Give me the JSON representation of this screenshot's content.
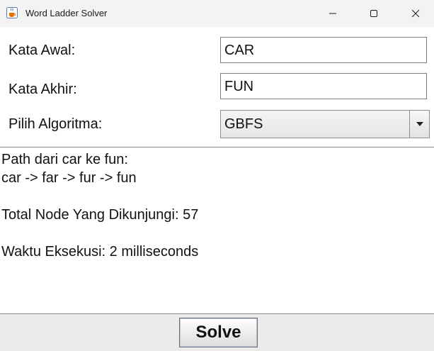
{
  "window": {
    "title": "Word Ladder Solver",
    "app_icon": "java-cup-icon",
    "controls": [
      "minimize-icon",
      "maximize-icon",
      "close-icon"
    ]
  },
  "form": {
    "start_label": "Kata Awal:",
    "start_value": "CAR",
    "end_label": "Kata Akhir:",
    "end_value": "FUN",
    "algorithm_label": "Pilih Algoritma:",
    "algorithm_value": "GBFS"
  },
  "output": {
    "lines": [
      "Path dari car ke fun:",
      "car -> far -> fur -> fun",
      "",
      "Total Node Yang Dikunjungi: 57",
      "",
      "Waktu Eksekusi: 2 milliseconds"
    ]
  },
  "actions": {
    "solve_label": "Solve"
  },
  "colors": {
    "titlebar": "#f3f3f3",
    "background": "#ffffff",
    "bottom_panel": "#ebebeb"
  }
}
